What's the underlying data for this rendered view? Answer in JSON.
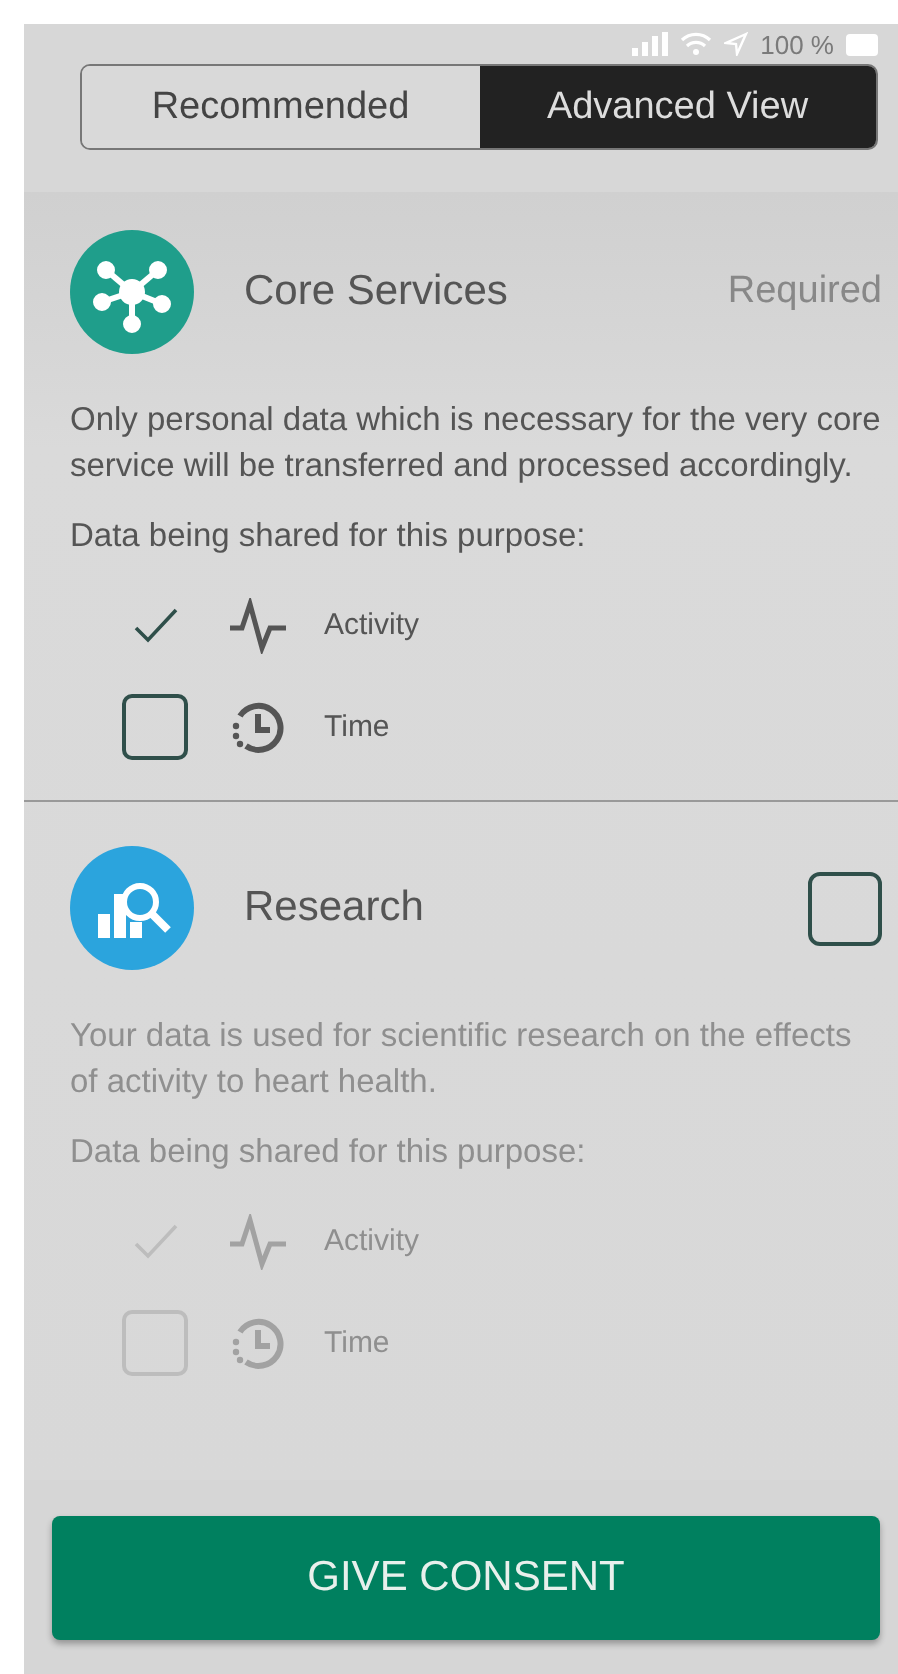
{
  "status_bar": {
    "battery": "100 %"
  },
  "view_toggle": [
    {
      "label": "Recommended",
      "selected": false
    },
    {
      "label": "Advanced View",
      "selected": true
    }
  ],
  "purposes": [
    {
      "title": "Core Services",
      "kind": "network",
      "color": "#1f9e8b",
      "status": "Required",
      "faded": false,
      "description": "Only personal data which is necessary for the very core service will be transferred and processed accordingly.",
      "shared_label": "Data being shared for this purpose:",
      "data_items": [
        {
          "label": "Activity",
          "kind": "pulse",
          "checked": true
        },
        {
          "label": "Time",
          "kind": "history",
          "checked": false
        }
      ]
    },
    {
      "title": "Research",
      "kind": "research",
      "color": "#2ba4dd",
      "checked": false,
      "faded": true,
      "description": "Your data is used for scientific research on the effects of activity to heart health.",
      "shared_label": "Data being shared for this purpose:",
      "data_items": [
        {
          "label": "Activity",
          "kind": "pulse",
          "checked": true
        },
        {
          "label": "Time",
          "kind": "history",
          "checked": false
        }
      ]
    }
  ],
  "consent_button": "GIVE CONSENT"
}
